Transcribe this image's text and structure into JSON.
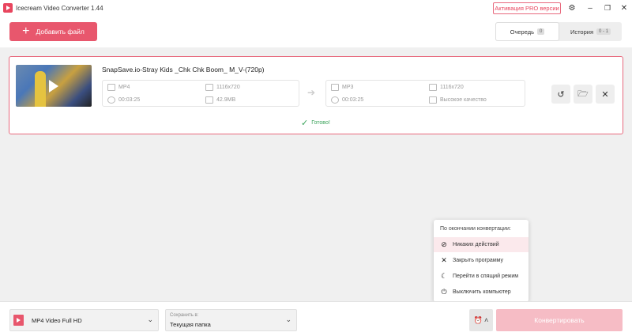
{
  "window": {
    "title": "Icecream Video Converter 1.44",
    "pro_label": "Активация PRO версии"
  },
  "header": {
    "add_file_label": "Добавить файл",
    "tabs": [
      {
        "label": "Очередь",
        "count": "0"
      },
      {
        "label": "История",
        "count": "0 - 1"
      }
    ]
  },
  "file": {
    "name": "SnapSave.io-Stray Kids _Chk Chk Boom_ M_V-(720p)",
    "source": {
      "format": "MP4",
      "resolution": "1116x720",
      "duration": "00:03:25",
      "size": "42.9MB"
    },
    "target": {
      "format": "MP3",
      "resolution": "1116x720",
      "duration": "00:03:25",
      "quality": "Высокое качество"
    },
    "status": "Готово!"
  },
  "after_conversion_menu": {
    "title": "По окончании конвертации:",
    "items": [
      {
        "label": "Никаких действий",
        "icon": "no-action-icon",
        "selected": true
      },
      {
        "label": "Закрыть программу",
        "icon": "close-icon",
        "selected": false
      },
      {
        "label": "Перейти в спящий режим",
        "icon": "moon-icon",
        "selected": false
      },
      {
        "label": "Выключить компьютер",
        "icon": "power-icon",
        "selected": false
      }
    ]
  },
  "bottom": {
    "format_value": "MP4 Video Full HD",
    "save_label": "Сохранить в:",
    "save_value": "Текущая папка",
    "convert_label": "Конвертировать"
  },
  "colors": {
    "accent": "#e8576d",
    "success": "#3aa35a"
  }
}
